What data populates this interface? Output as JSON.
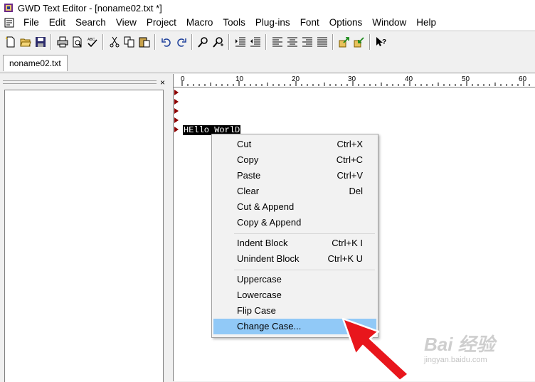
{
  "window": {
    "title": "GWD Text Editor - [noname02.txt *]"
  },
  "menubar": {
    "items": [
      "File",
      "Edit",
      "Search",
      "View",
      "Project",
      "Macro",
      "Tools",
      "Plug-ins",
      "Font",
      "Options",
      "Window",
      "Help"
    ]
  },
  "toolbar": {
    "buttons": [
      "new-icon",
      "open-icon",
      "save-icon",
      "print-icon",
      "print-preview-icon",
      "spellcheck-icon",
      "cut-icon",
      "copy-icon",
      "paste-icon",
      "undo-icon",
      "redo-icon",
      "find-icon",
      "find-next-icon",
      "indent-icon",
      "unindent-icon",
      "align-left-icon",
      "align-center-icon",
      "align-right-icon",
      "justify-icon",
      "export-icon",
      "import-icon",
      "help-icon"
    ]
  },
  "tabs": [
    {
      "label": "noname02.txt"
    }
  ],
  "left_panel": {
    "close": "×"
  },
  "ruler": {
    "labels": [
      "0",
      "10",
      "20",
      "30",
      "40",
      "50",
      "60"
    ]
  },
  "editor": {
    "selected_text": "HEllo WorlD"
  },
  "context_menu": {
    "items": [
      {
        "label": "Cut",
        "shortcut": "Ctrl+X"
      },
      {
        "label": "Copy",
        "shortcut": "Ctrl+C"
      },
      {
        "label": "Paste",
        "shortcut": "Ctrl+V"
      },
      {
        "label": "Clear",
        "shortcut": "Del"
      },
      {
        "label": "Cut & Append",
        "shortcut": ""
      },
      {
        "label": "Copy & Append",
        "shortcut": ""
      },
      {
        "label": "Indent Block",
        "shortcut": "Ctrl+K I"
      },
      {
        "label": "Unindent Block",
        "shortcut": "Ctrl+K U"
      },
      {
        "label": "Uppercase",
        "shortcut": ""
      },
      {
        "label": "Lowercase",
        "shortcut": ""
      },
      {
        "label": "Flip Case",
        "shortcut": ""
      },
      {
        "label": "Change Case...",
        "shortcut": ""
      }
    ],
    "highlighted_index": 11
  },
  "watermark": {
    "brand": "Bai 经验",
    "url": "jingyan.baidu.com"
  },
  "colors": {
    "highlight": "#91c9f7",
    "arrow": "#e8161c",
    "gutter_marker": "#8b0000"
  }
}
